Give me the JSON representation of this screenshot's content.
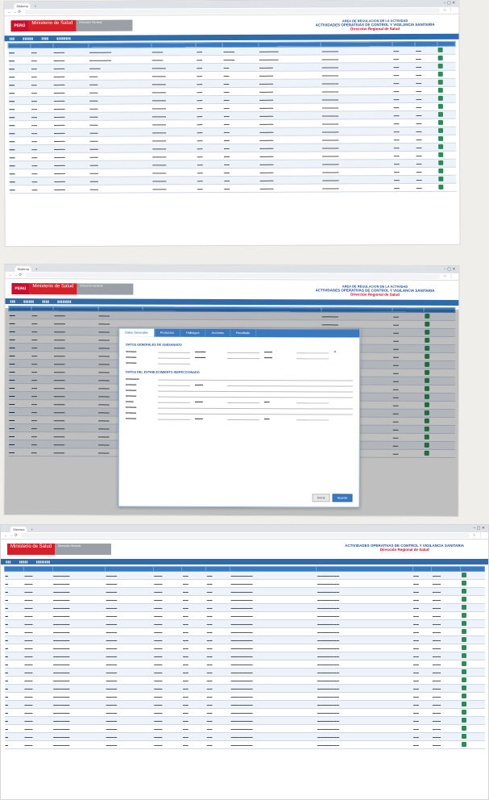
{
  "browser": {
    "tab_title": "Sistema",
    "new_tab_label": "+"
  },
  "header": {
    "peru_label": "PERÚ",
    "ministry": "Ministerio de Salud",
    "dependency": "Dirección General",
    "title_line1": "AREA DE REGULACION DE LA ACTIVIDAD",
    "title_line2": "ACTIVIDADES OPERATIVAS DE CONTROL Y VIGILANCIA SANITARIA",
    "region": "Dirección Regional de Salud"
  },
  "modal": {
    "tabs": [
      "Datos Generales",
      "Productos",
      "Hallazgos",
      "Acciones",
      "Resultado"
    ],
    "section1": "DATOS GENERALES DE SUBSANADO",
    "section2": "DATOS DEL ESTABLECIMIENTO INSPECCIONADO",
    "buttons": {
      "cancel": "Cerrar",
      "save": "Guardar"
    }
  },
  "colors": {
    "brand_red": "#c8102e",
    "table_header_blue": "#3a79bd",
    "title_blue": "#1f4e9a",
    "status_green": "#2e8b57"
  }
}
